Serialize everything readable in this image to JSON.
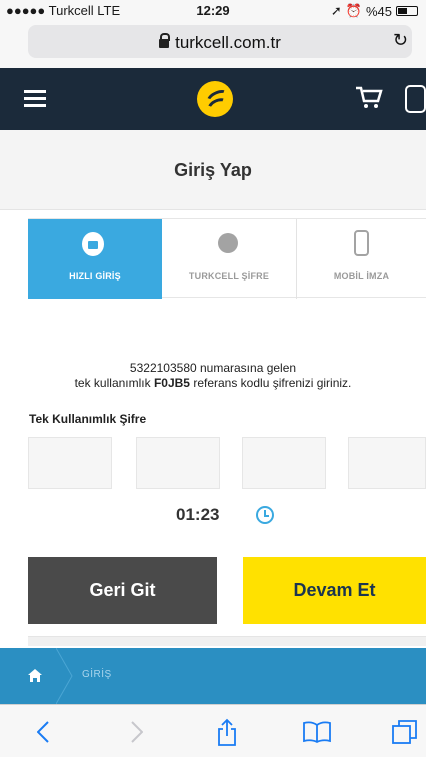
{
  "status_bar": {
    "carrier": "●●●●● Turkcell  LTE",
    "time": "12:29",
    "battery": "%45"
  },
  "browser": {
    "url": "turkcell.com.tr",
    "icons": [
      "lock-icon",
      "reload-icon"
    ]
  },
  "header": {
    "icons": [
      "hamburger-menu-icon",
      "turkcell-logo",
      "cart-icon",
      "phone-icon"
    ]
  },
  "page": {
    "title": "Giriş Yap"
  },
  "tabs": [
    {
      "label": "HIZLI GİRİŞ",
      "active": true,
      "icon": "lock-icon"
    },
    {
      "label": "TURKCELL ŞİFRE",
      "active": false,
      "icon": "turkcell-icon"
    },
    {
      "label": "MOBİL İMZA",
      "active": false,
      "icon": "mobile-icon"
    }
  ],
  "instructions": {
    "line1": "5322103580 numarasına gelen",
    "line2_pre": "tek kullanımlık ",
    "line2_code": "F0JB5",
    "line2_post": " referans kodlu şifrenizi giriniz."
  },
  "otp": {
    "label": "Tek Kullanımlık Şifre",
    "boxes": [
      "",
      "",
      "",
      ""
    ]
  },
  "timer": {
    "value": "01:23"
  },
  "actions": {
    "back_label": "Geri Git",
    "next_label": "Devam Et"
  },
  "breadcrumb": {
    "current": "GİRİŞ"
  },
  "colors": {
    "navy": "#1b2a3a",
    "blue": "#3aa9e0",
    "yellow": "#ffe100",
    "crumb": "#2b8fc2",
    "ios_blue": "#1a7cf4"
  }
}
